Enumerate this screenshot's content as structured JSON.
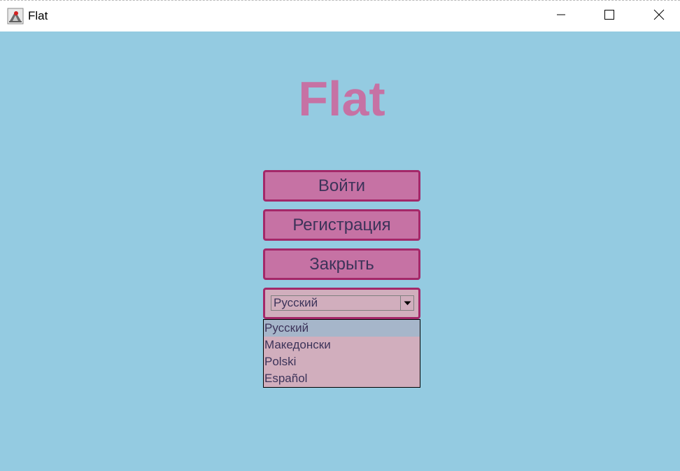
{
  "window": {
    "title": "Flat",
    "icon": "java-app-icon",
    "controls": [
      "minimize-icon",
      "maximize-icon",
      "close-icon"
    ]
  },
  "main": {
    "heading": "Flat",
    "buttons": {
      "login": "Войти",
      "register": "Регистрация",
      "close": "Закрыть"
    },
    "language": {
      "selected": "Русский",
      "options": [
        "Русский",
        "Македонски",
        "Polski",
        "Español"
      ],
      "highlighted_index": 0
    }
  },
  "colors": {
    "background": "#94cbe1",
    "heading": "#c672a4",
    "button_fill": "#c672a4",
    "button_border": "#a42869",
    "button_text": "#3c3359",
    "combo_fill": "#d1aebd",
    "list_highlight": "#a6b6ca"
  }
}
